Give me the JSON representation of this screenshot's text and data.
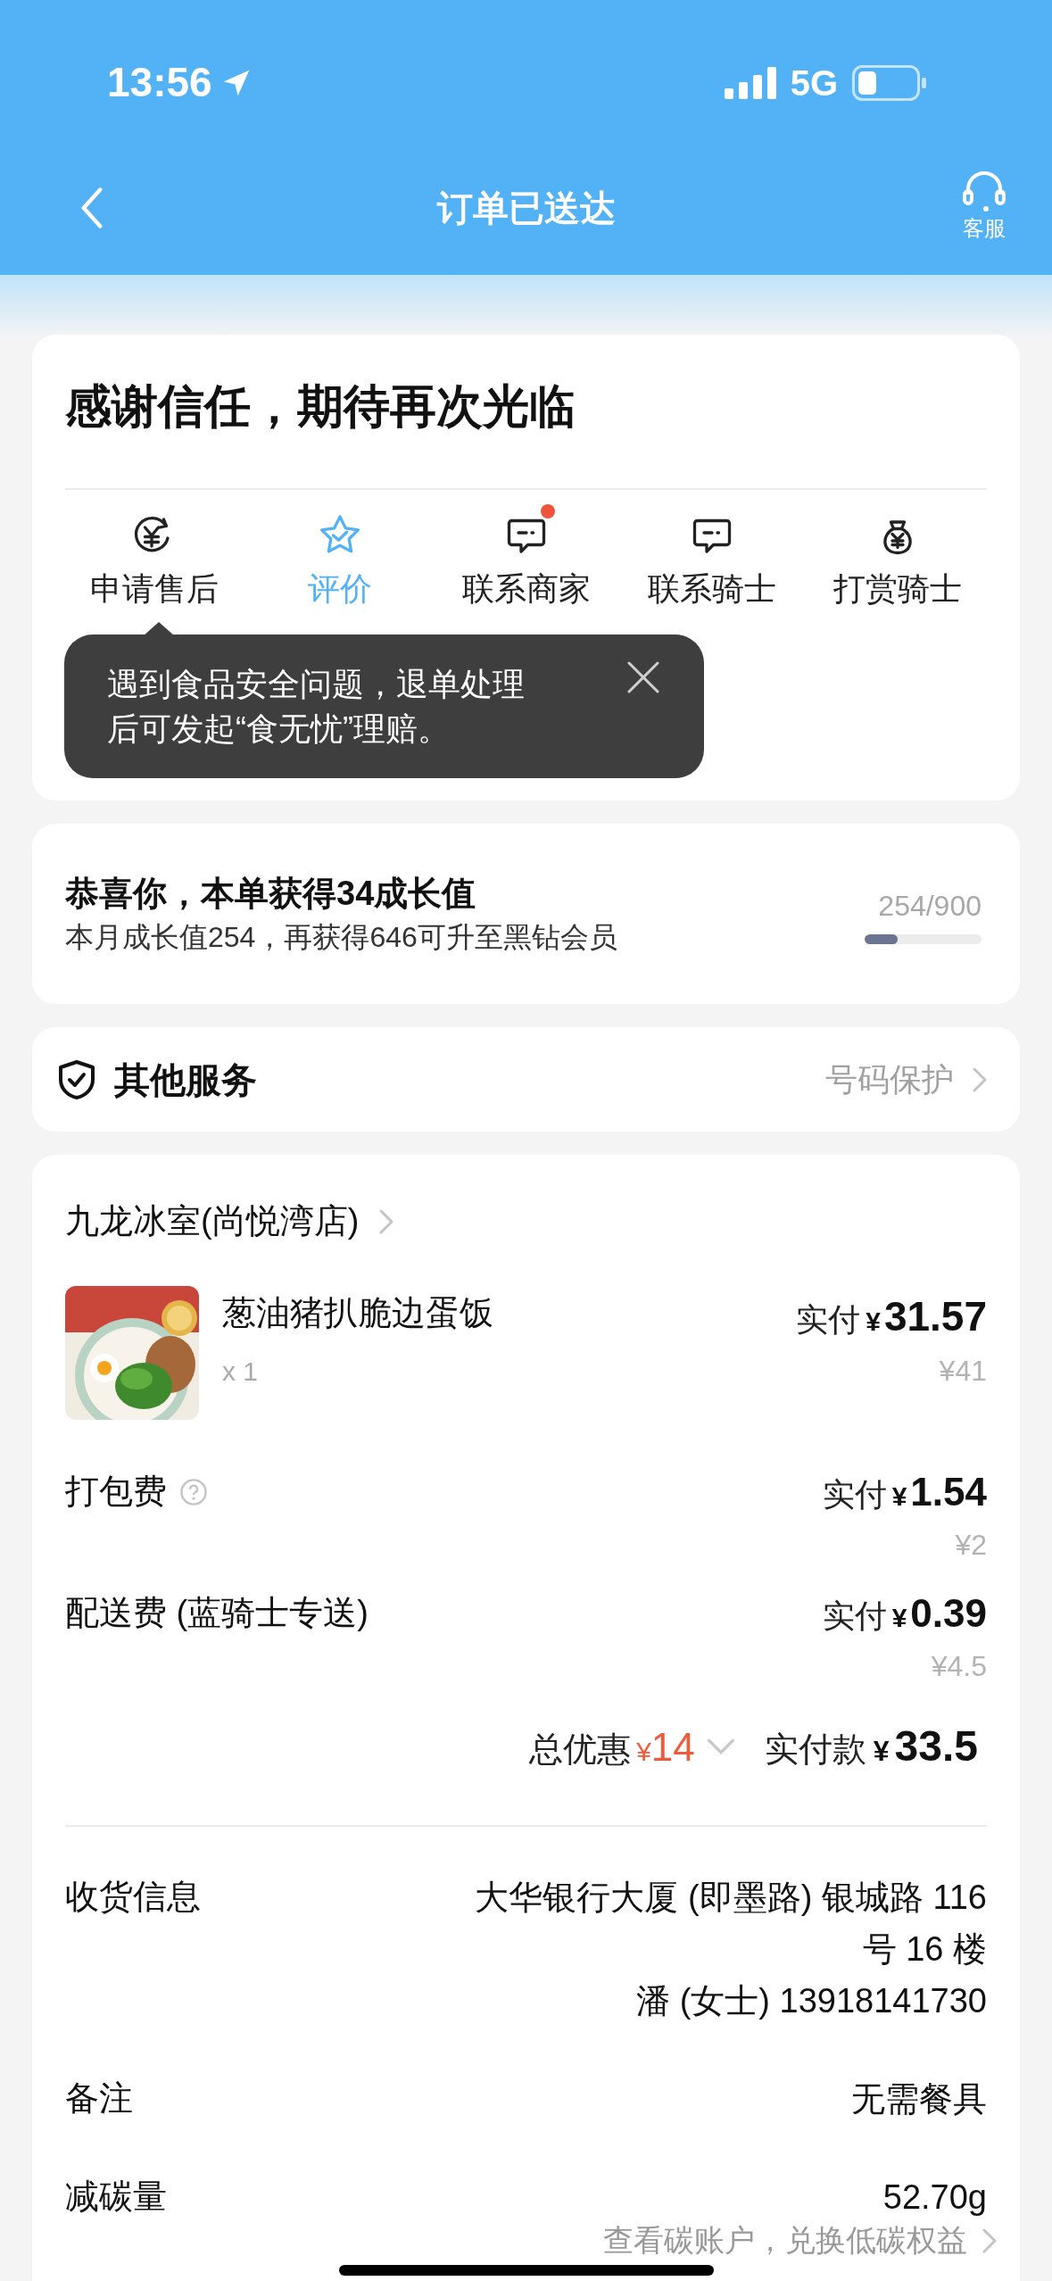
{
  "status_bar": {
    "time": "13:56",
    "network": "5G"
  },
  "header": {
    "title": "订单已送达",
    "service_label": "客服"
  },
  "thanks_card": {
    "title": "感谢信任，期待再次光临",
    "actions": [
      {
        "label": "申请售后",
        "selected": false,
        "badge_dot": false
      },
      {
        "label": "评价",
        "selected": true,
        "badge_dot": false
      },
      {
        "label": "联系商家",
        "selected": false,
        "badge_dot": true
      },
      {
        "label": "联系骑士",
        "selected": false,
        "badge_dot": false
      },
      {
        "label": "打赏骑士",
        "selected": false,
        "badge_dot": false
      }
    ],
    "tooltip": {
      "text": "遇到食品安全问题，退单处理后可发起“食无忧”理赔。"
    }
  },
  "growth_card": {
    "title": "恭喜你，本单获得34成长值",
    "subtitle": "本月成长值254，再获得646可升至黑钻会员",
    "progress_text": "254/900",
    "level": 0.28
  },
  "services_card": {
    "title": "其他服务",
    "link": "号码保护"
  },
  "order_card": {
    "store": "九龙冰室(尚悦湾店)",
    "item": {
      "name": "葱油猪扒脆边蛋饭",
      "qty": "x 1",
      "paid_label": "实付",
      "currency": "¥",
      "amount": "31.57",
      "original": "¥41"
    },
    "fees": [
      {
        "label": "打包费",
        "help": true,
        "paid_label": "实付",
        "currency": "¥",
        "amount": "1.54",
        "original": "¥2"
      },
      {
        "label": "配送费 (蓝骑士专送)",
        "help": false,
        "paid_label": "实付",
        "currency": "¥",
        "amount": "0.39",
        "original": "¥4.5"
      }
    ],
    "summary": {
      "discount_label": "总优惠",
      "discount_currency": "¥",
      "discount": "14",
      "total_label": "实付款",
      "total_currency": "¥",
      "total": "33.5"
    },
    "info": [
      {
        "label": "收货信息",
        "lines": [
          "大华银行大厦 (即墨路) 银城路 116",
          "号 16 楼",
          "潘 (女士) 13918141730"
        ]
      },
      {
        "label": "备注",
        "lines": [
          "无需餐具"
        ]
      },
      {
        "label": "减碳量",
        "lines": [
          "52.70g"
        ]
      }
    ],
    "carbon_link": "查看碳账户，兑换低碳权益"
  }
}
